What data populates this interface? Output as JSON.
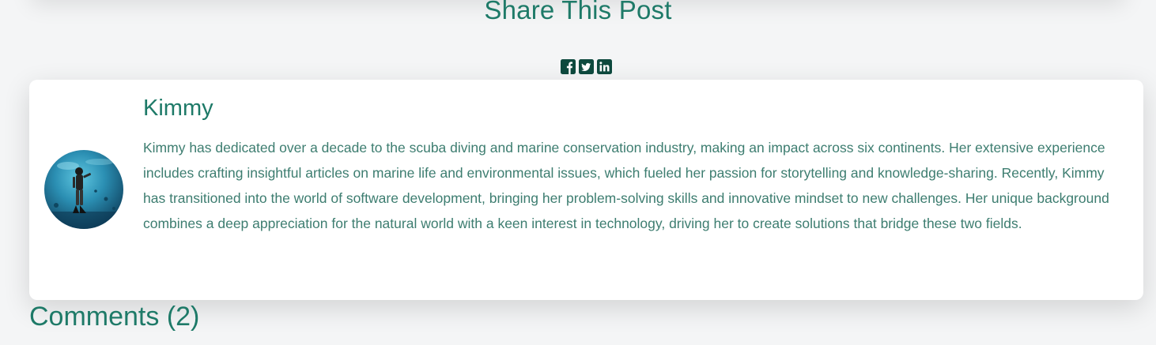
{
  "share": {
    "title": "Share This Post",
    "icons": [
      "facebook-icon",
      "twitter-icon",
      "linkedin-icon"
    ]
  },
  "author": {
    "name": "Kimmy",
    "bio": "Kimmy has dedicated over a decade to the scuba diving and marine conservation industry, making an impact across six continents. Her extensive experience includes crafting insightful articles on marine life and environmental issues, which fueled her passion for storytelling and knowledge-sharing. Recently, Kimmy has transitioned into the world of software development, bringing her problem-solving skills and innovative mindset to new challenges. Her unique background combines a deep appreciation for the natural world with a keen interest in technology, driving her to create solutions that bridge these two fields."
  },
  "comments": {
    "title": "Comments (2)"
  },
  "colors": {
    "accent": "#1e7a68",
    "icon": "#0e4a3e",
    "background": "#f4f5f6",
    "card": "#ffffff"
  }
}
